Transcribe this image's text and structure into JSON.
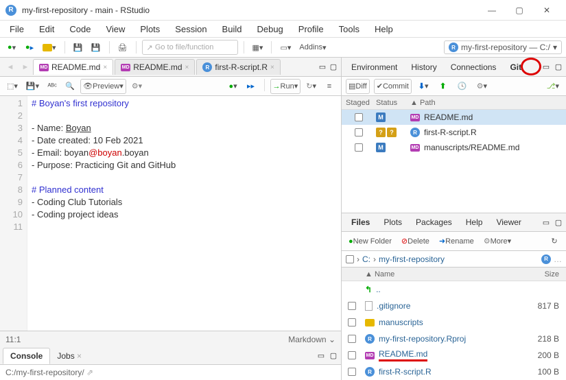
{
  "window": {
    "title": "my-first-repository - main - RStudio",
    "appicon_letter": "R"
  },
  "menu": [
    "File",
    "Edit",
    "Code",
    "View",
    "Plots",
    "Session",
    "Build",
    "Debug",
    "Profile",
    "Tools",
    "Help"
  ],
  "toolbar": {
    "goto_placeholder": "Go to file/function",
    "addins": "Addins",
    "project_name": "my-first-repository — C:/"
  },
  "editor": {
    "tabs": [
      {
        "name": "README.md",
        "icon": "md"
      },
      {
        "name": "README.md",
        "icon": "md"
      },
      {
        "name": "first-R-script.R",
        "icon": "r"
      }
    ],
    "toolbar": {
      "preview": "Preview",
      "run": "Run"
    },
    "lines": [
      {
        "n": 1,
        "text": "# Boyan's first repository",
        "cls": "h"
      },
      {
        "n": 2,
        "text": ""
      },
      {
        "n": 3,
        "pre": "- Name: ",
        "u": "Boyan"
      },
      {
        "n": 4,
        "text": "- Date created: 10 Feb 2021"
      },
      {
        "n": 5,
        "pre": "- Email: boyan",
        "mail": "@boyan",
        "post": ".boyan"
      },
      {
        "n": 6,
        "text": "- Purpose: Practicing Git and GitHub"
      },
      {
        "n": 7,
        "text": ""
      },
      {
        "n": 8,
        "text": "# Planned content",
        "cls": "h"
      },
      {
        "n": 9,
        "text": "- Coding Club Tutorials"
      },
      {
        "n": 10,
        "text": "- Coding project ideas"
      },
      {
        "n": 11,
        "text": ""
      }
    ],
    "status_left": "11:1",
    "status_right": "Markdown"
  },
  "console": {
    "tabs": [
      "Console",
      "Jobs"
    ],
    "path": "C:/my-first-repository/"
  },
  "env_pane": {
    "tabs": [
      "Environment",
      "History",
      "Connections",
      "Git"
    ],
    "git_toolbar": {
      "diff": "Diff",
      "commit": "Commit"
    },
    "git_head": {
      "staged": "Staged",
      "status": "Status",
      "path": "Path"
    },
    "git_rows": [
      {
        "status": [
          "M"
        ],
        "path": "README.md",
        "icon": "md",
        "sel": true
      },
      {
        "status": [
          "?",
          "?"
        ],
        "path": "first-R-script.R",
        "icon": "r"
      },
      {
        "status": [
          "M"
        ],
        "path": "manuscripts/README.md",
        "icon": "md"
      }
    ]
  },
  "files_pane": {
    "tabs": [
      "Files",
      "Plots",
      "Packages",
      "Help",
      "Viewer"
    ],
    "toolbar": {
      "new_folder": "New Folder",
      "delete": "Delete",
      "rename": "Rename",
      "more": "More"
    },
    "breadcrumb": [
      "C:",
      "my-first-repository"
    ],
    "head": {
      "name": "Name",
      "size": "Size"
    },
    "rows": [
      {
        "name": "..",
        "type": "up"
      },
      {
        "name": ".gitignore",
        "type": "txt",
        "size": "817 B"
      },
      {
        "name": "manuscripts",
        "type": "folder"
      },
      {
        "name": "my-first-repository.Rproj",
        "type": "r",
        "size": "218 B"
      },
      {
        "name": "README.md",
        "type": "md",
        "size": "200 B",
        "hl": true
      },
      {
        "name": "first-R-script.R",
        "type": "r",
        "size": "100 B"
      }
    ]
  }
}
